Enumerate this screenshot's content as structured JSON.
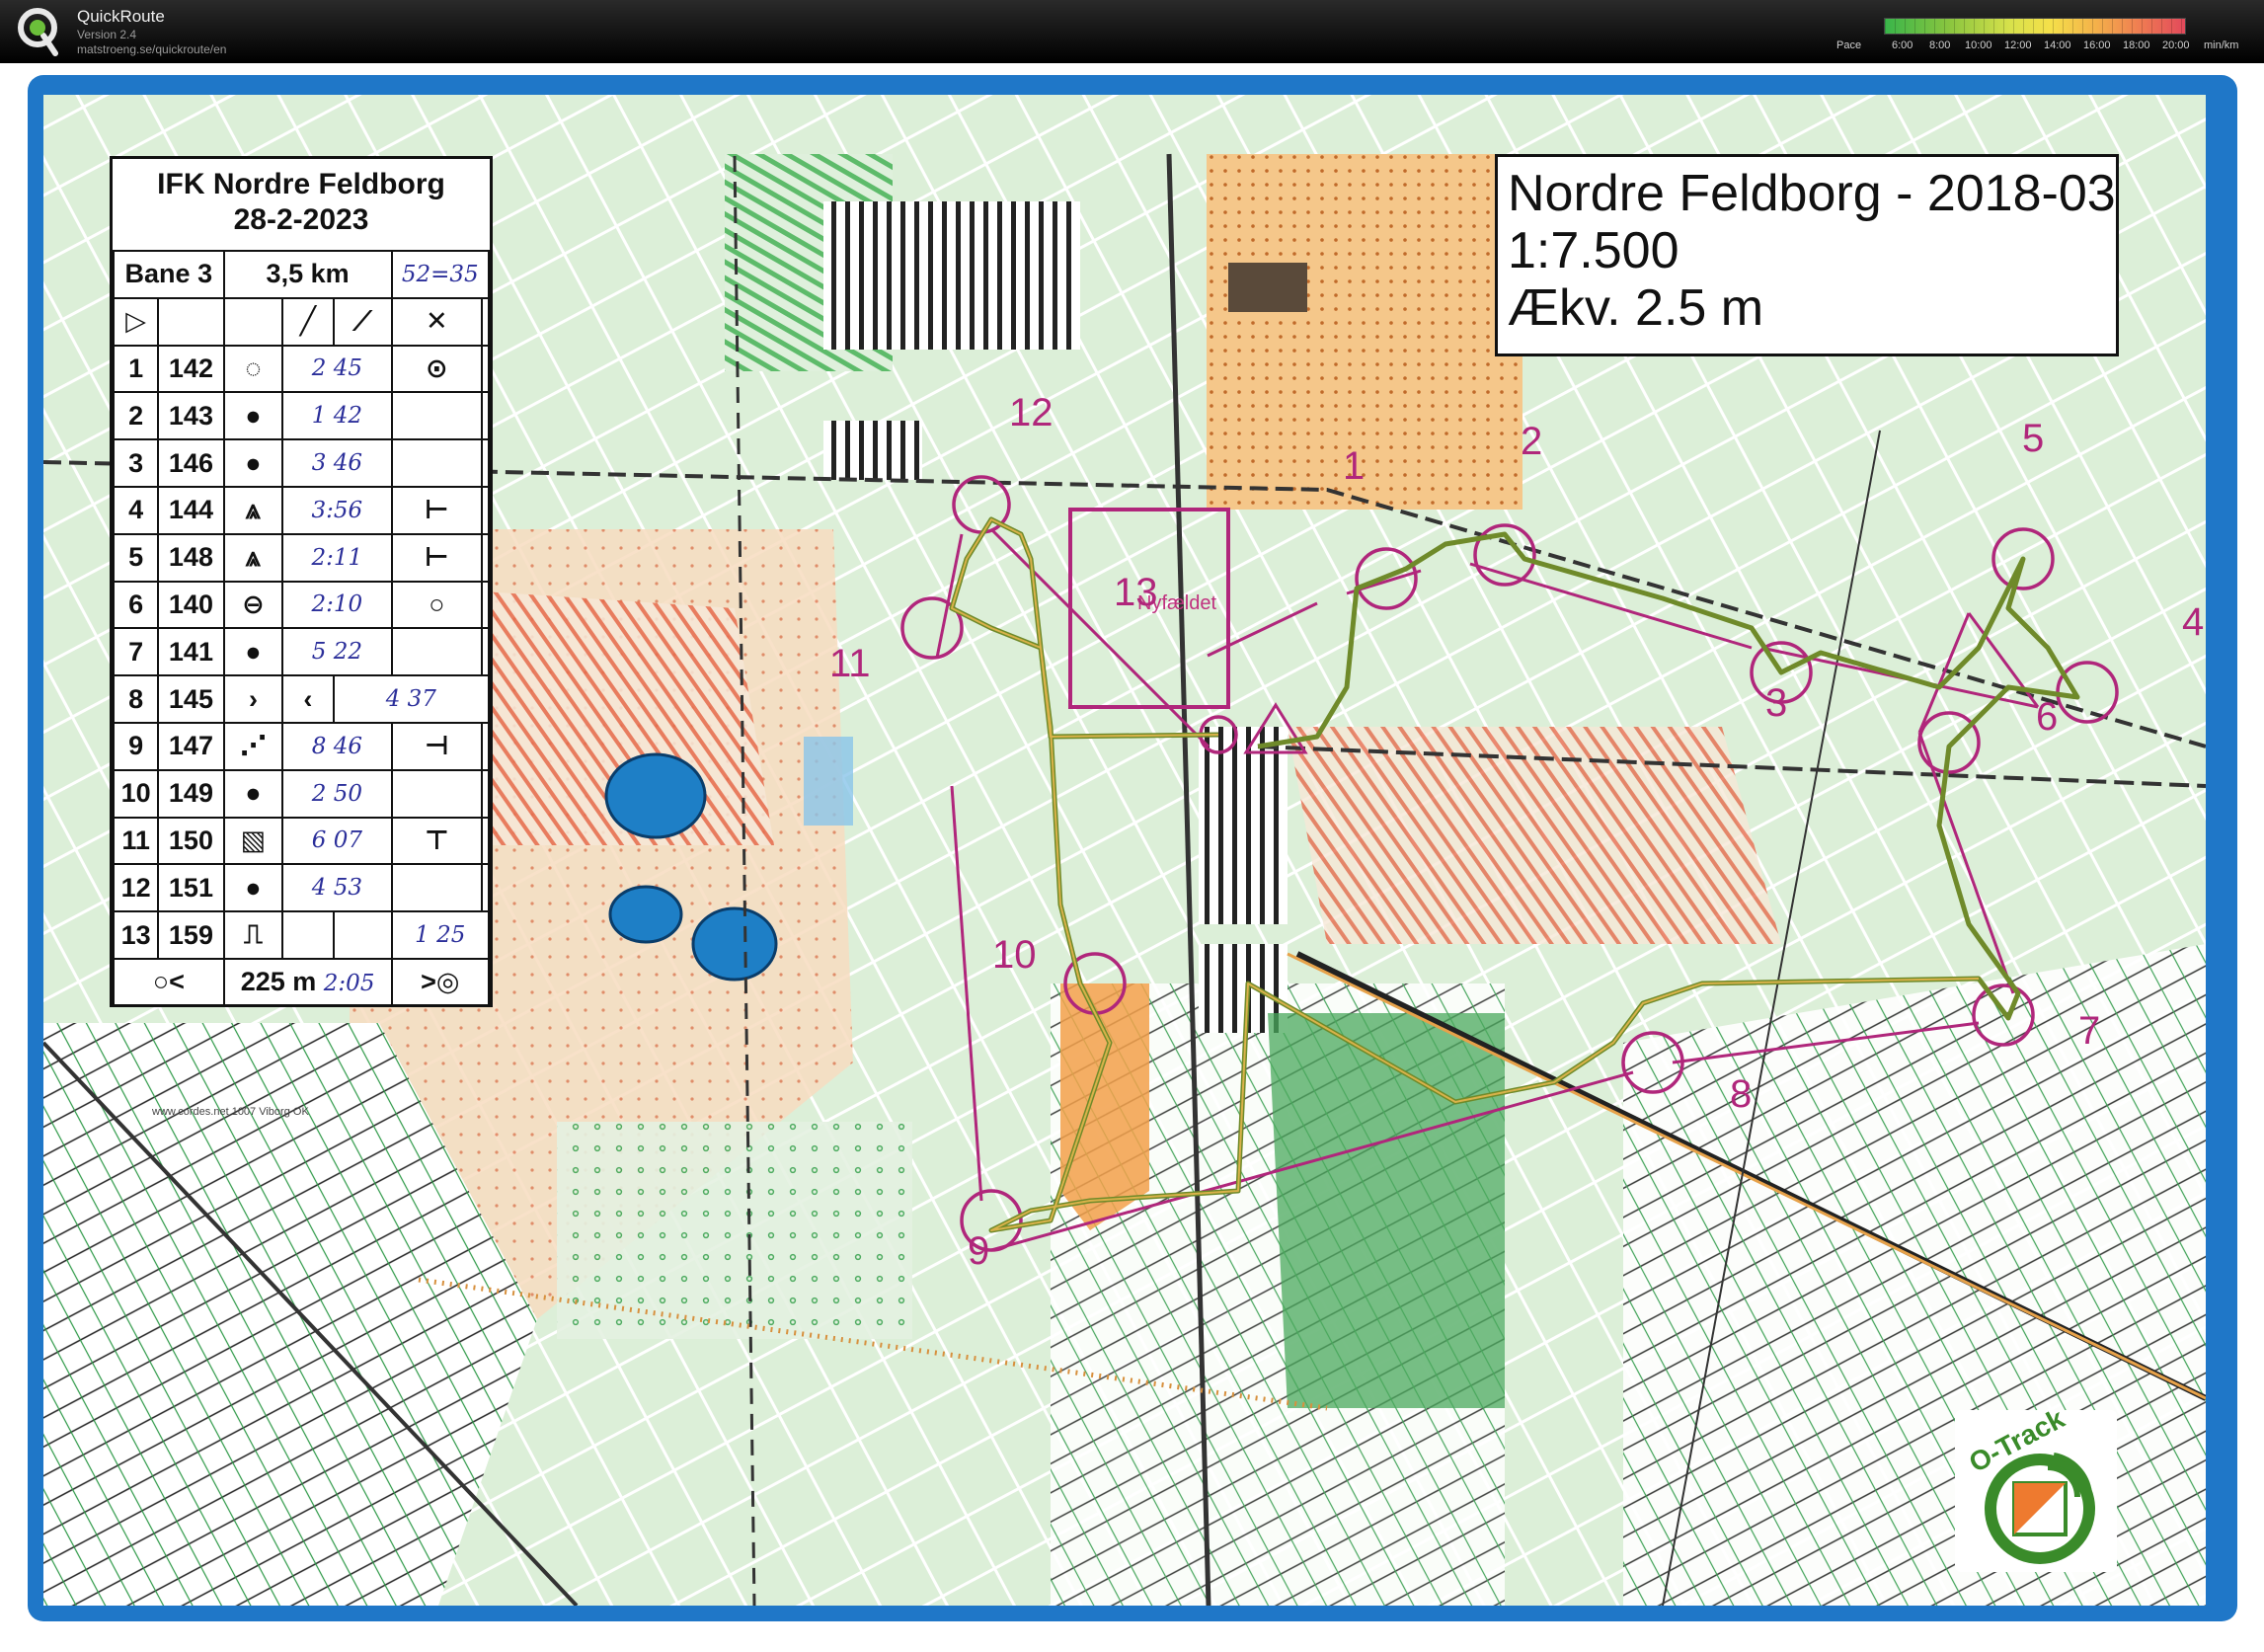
{
  "app": {
    "name": "QuickRoute",
    "version": "Version 2.4",
    "url": "matstroeng.se/quickroute/en"
  },
  "pace_legend": {
    "label": "Pace",
    "ticks": [
      "6:00",
      "8:00",
      "10:00",
      "12:00",
      "14:00",
      "16:00",
      "18:00",
      "20:00"
    ],
    "unit": "min/km",
    "colors": [
      "#39b54a",
      "#8cc63f",
      "#d8e14b",
      "#f5e04a",
      "#f4b24a",
      "#ef7c52",
      "#e2495b"
    ]
  },
  "map_info": {
    "title": "Nordre Feldborg - 2018-03",
    "scale": "1:7.500",
    "equidistance": "Ækv. 2.5 m"
  },
  "control_card": {
    "event": "IFK Nordre Feldborg",
    "date": "28-2-2023",
    "course": "Bane 3",
    "length": "3,5 km",
    "total_time": "52=35",
    "header_symbols": [
      "▷",
      "",
      "",
      "╱",
      "⟋",
      "✕",
      ""
    ],
    "rows": [
      {
        "num": "1",
        "code": "142",
        "feature": "◌",
        "time": "2 45",
        "extra": "⊙"
      },
      {
        "num": "2",
        "code": "143",
        "feature": "●",
        "time": "1 42",
        "extra": ""
      },
      {
        "num": "3",
        "code": "146",
        "feature": "●",
        "time": "3 46",
        "extra": ""
      },
      {
        "num": "4",
        "code": "144",
        "feature": "⩓",
        "time": "3:56",
        "extra": "⊢"
      },
      {
        "num": "5",
        "code": "148",
        "feature": "⩓",
        "time": "2:11",
        "extra": "⊢"
      },
      {
        "num": "6",
        "code": "140",
        "feature": "⊖",
        "time": "2:10",
        "extra": "○"
      },
      {
        "num": "7",
        "code": "141",
        "feature": "●",
        "time": "5 22",
        "extra": ""
      },
      {
        "num": "8",
        "code": "145",
        "feature": "›",
        "time": "4 37",
        "extra": "‹"
      },
      {
        "num": "9",
        "code": "147",
        "feature": "⋰",
        "time": "8 46",
        "extra": "⊣"
      },
      {
        "num": "10",
        "code": "149",
        "feature": "●",
        "time": "2 50",
        "extra": ""
      },
      {
        "num": "11",
        "code": "150",
        "feature": "▧",
        "time": "6 07",
        "extra": "⊤"
      },
      {
        "num": "12",
        "code": "151",
        "feature": "●",
        "time": "4 53",
        "extra": ""
      },
      {
        "num": "13",
        "code": "159",
        "feature": "⎍",
        "time": "1 25",
        "extra": ""
      }
    ],
    "finish": {
      "distance": "225 m",
      "time": "2:05"
    },
    "print_url": "www.cordes.net 1007 Viborg OK"
  },
  "map_labels": {
    "nyfaeldet": "Nyfældet",
    "controls": [
      "1",
      "2",
      "3",
      "4",
      "5",
      "6",
      "7",
      "8",
      "9",
      "10",
      "11",
      "12",
      "13"
    ]
  },
  "badge": {
    "name": "O-Track"
  },
  "route_colors": {
    "course": "#b0267b",
    "track_slow": "#d48a2a",
    "track_fast": "#3a8b2a"
  }
}
